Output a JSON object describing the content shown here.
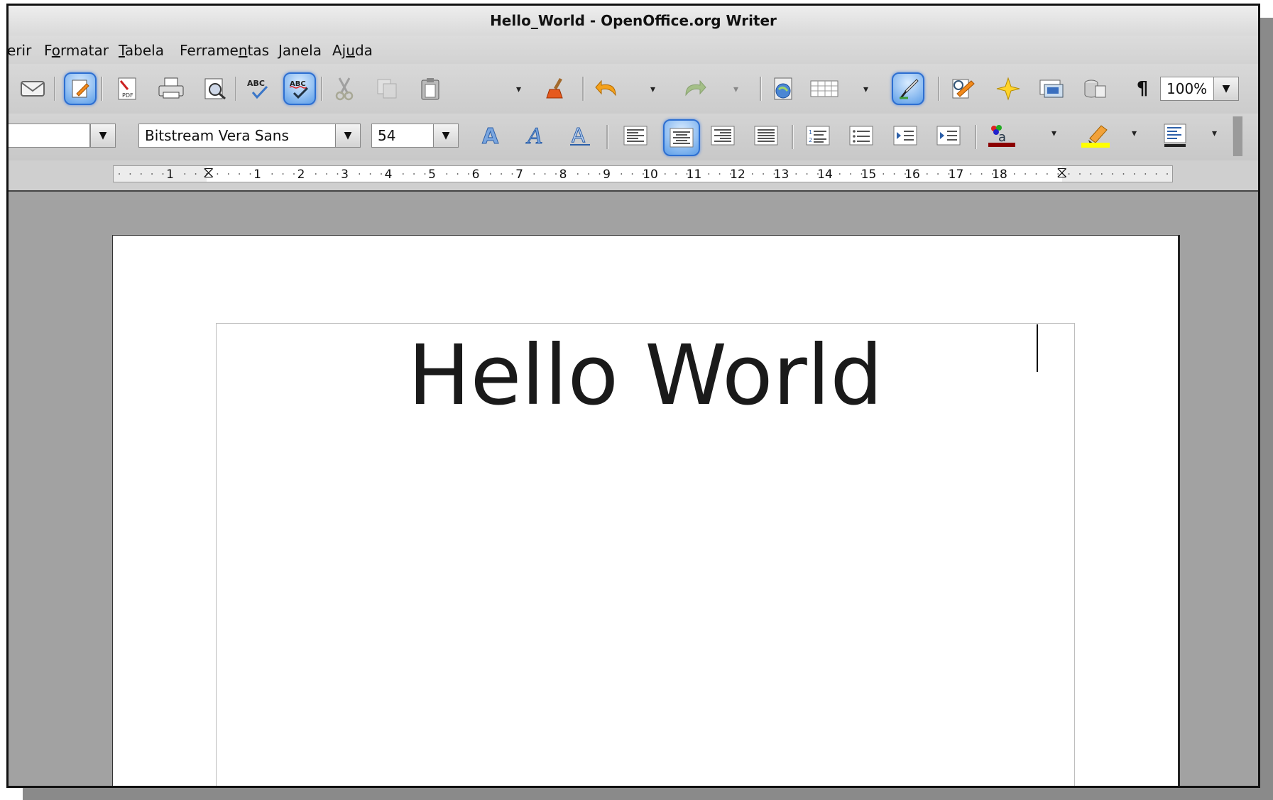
{
  "window": {
    "title": "Hello_World - OpenOffice.org Writer"
  },
  "menu": {
    "items": [
      {
        "label": "erir",
        "underline": ""
      },
      {
        "label": "Formatar",
        "underline": "o"
      },
      {
        "label": "Tabela",
        "underline": "T"
      },
      {
        "label": "Ferramentas",
        "underline": "n"
      },
      {
        "label": "Janela",
        "underline": "J"
      },
      {
        "label": "Ajuda",
        "underline": "u"
      }
    ]
  },
  "standard_toolbar": {
    "icons": [
      "email-icon",
      "edit-file-icon",
      "export-pdf-icon",
      "print-icon",
      "page-preview-icon",
      "spellcheck-icon",
      "autospellcheck-icon",
      "cut-icon",
      "copy-icon",
      "paste-icon",
      "clone-formatting-icon",
      "undo-icon",
      "redo-icon",
      "hyperlink-icon",
      "table-icon",
      "draw-functions-icon",
      "find-replace-icon",
      "navigator-icon",
      "gallery-icon",
      "data-sources-icon",
      "formatting-marks-icon"
    ],
    "zoom": "100%"
  },
  "formatting_toolbar": {
    "paragraph_style": "",
    "font_name": "Bitstream Vera Sans",
    "font_size": "54",
    "alignment": "center"
  },
  "ruler": {
    "labels": [
      "1",
      "1",
      "2",
      "3",
      "4",
      "5",
      "6",
      "7",
      "8",
      "9",
      "10",
      "11",
      "12",
      "13",
      "14",
      "15",
      "16",
      "17",
      "18"
    ]
  },
  "document": {
    "text": "Hello World"
  }
}
